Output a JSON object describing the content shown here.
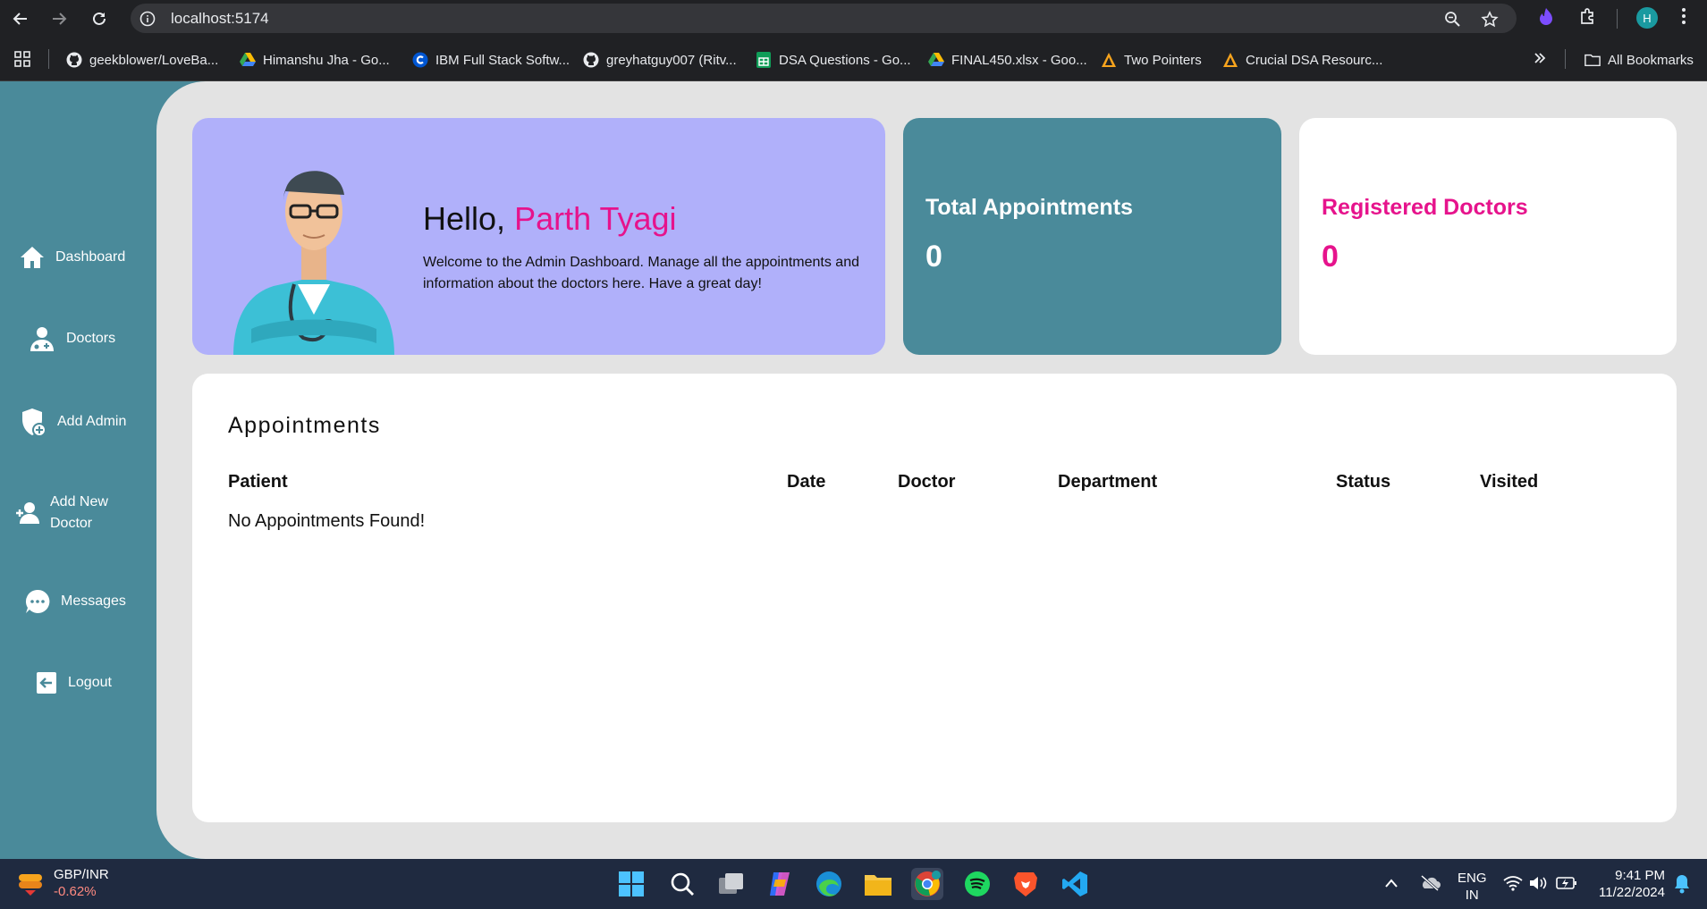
{
  "browser": {
    "url": "localhost:5174",
    "profile_initial": "H",
    "bookmarks": [
      {
        "label": "geekblower/LoveBa...",
        "icon": "github-icon"
      },
      {
        "label": "Himanshu Jha - Go...",
        "icon": "google-drive-icon"
      },
      {
        "label": "IBM Full Stack Softw...",
        "icon": "coursera-icon"
      },
      {
        "label": "greyhatguy007 (Ritv...",
        "icon": "github-icon"
      },
      {
        "label": "DSA Questions - Go...",
        "icon": "google-sheets-icon"
      },
      {
        "label": "FINAL450.xlsx - Goo...",
        "icon": "google-drive-icon"
      },
      {
        "label": "Two Pointers",
        "icon": "site-icon"
      },
      {
        "label": "Crucial DSA Resourc...",
        "icon": "site-icon"
      }
    ],
    "all_bookmarks": "All Bookmarks"
  },
  "sidebar": {
    "items": [
      {
        "label": "Dashboard",
        "icon": "home-icon"
      },
      {
        "label": "Doctors",
        "icon": "doctor-icon"
      },
      {
        "label": "Add Admin",
        "icon": "shield-plus-icon"
      },
      {
        "label": "Add New Doctor",
        "line1": "Add New",
        "line2": "Doctor",
        "icon": "add-user-icon"
      },
      {
        "label": "Messages",
        "icon": "chat-icon"
      },
      {
        "label": "Logout",
        "icon": "logout-icon"
      }
    ]
  },
  "hero": {
    "greeting": "Hello,",
    "name": "Parth Tyagi",
    "text": "Welcome to the Admin Dashboard. Manage all the appointments and information about the doctors here. Have a great day!"
  },
  "stats": {
    "appointments": {
      "title": "Total Appointments",
      "value": "0"
    },
    "doctors": {
      "title": "Registered Doctors",
      "value": "0"
    }
  },
  "appointments": {
    "title": "Appointments",
    "columns": [
      "Patient",
      "Date",
      "Doctor",
      "Department",
      "Status",
      "Visited"
    ],
    "empty_text": "No Appointments Found!"
  },
  "taskbar": {
    "ticker_symbol": "GBP/INR",
    "ticker_change": "-0.62%",
    "language_line1": "ENG",
    "language_line2": "IN",
    "time": "9:41 PM",
    "date": "11/22/2024"
  },
  "colors": {
    "accent_pink": "#e6138c",
    "teal": "#4a8a9a",
    "hero_bg": "#b0b0fa"
  }
}
